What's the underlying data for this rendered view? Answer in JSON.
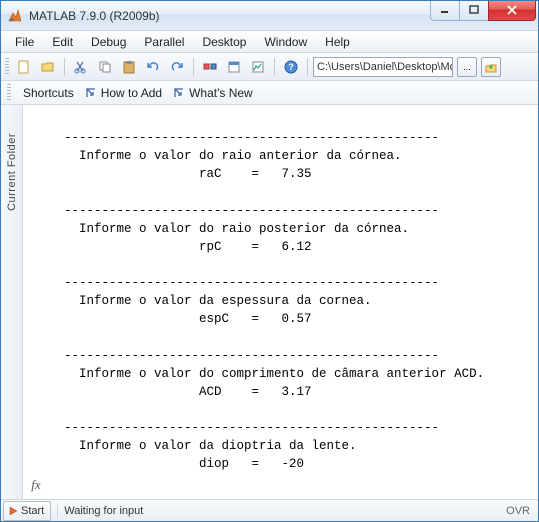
{
  "window": {
    "title": "MATLAB  7.9.0 (R2009b)"
  },
  "menubar": {
    "items": [
      "File",
      "Edit",
      "Debug",
      "Parallel",
      "Desktop",
      "Window",
      "Help"
    ]
  },
  "toolbar": {
    "path_value": "C:\\Users\\Daniel\\Desktop\\Mo"
  },
  "shortcuts": {
    "label": "Shortcuts",
    "howto": "How to Add",
    "whatsnew": "What's New"
  },
  "sidetab": {
    "label": "Current Folder"
  },
  "console": {
    "lines": [
      "",
      "  --------------------------------------------------",
      "    Informe o valor do raio anterior da córnea.",
      "                    raC    =   7.35 ",
      "",
      "  --------------------------------------------------",
      "    Informe o valor do raio posterior da córnea.",
      "                    rpC    =   6.12 ",
      "",
      "  --------------------------------------------------",
      "    Informe o valor da espessura da cornea.",
      "                    espC   =   0.57",
      "",
      "  --------------------------------------------------",
      "    Informe o valor do comprimento de câmara anterior ACD.",
      "                    ACD    =   3.17",
      "",
      "  --------------------------------------------------",
      "    Informe o valor da dioptria da lente.",
      "                    diop   =   -20"
    ]
  },
  "fx_label": "fx",
  "statusbar": {
    "start": "Start",
    "message": "Waiting for input",
    "ovr": "OVR"
  }
}
